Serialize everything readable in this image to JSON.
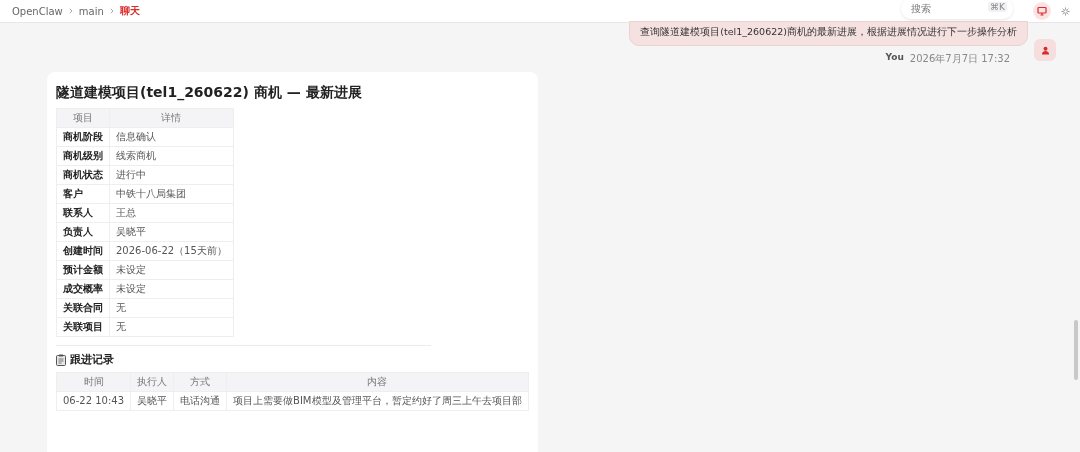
{
  "breadcrumb": [
    {
      "label": "OpenClaw",
      "selected": false
    },
    {
      "label": "main",
      "selected": false
    },
    {
      "label": "聊天",
      "selected": true
    }
  ],
  "search": {
    "placeholder": "搜索",
    "shortcut": "⌘K"
  },
  "message": {
    "text": "查询隧道建模项目(tel1_260622)商机的最新进展，根据进展情况进行下一步操作分析",
    "author": "You",
    "time": "2026年7月7日 17:32"
  },
  "reply": {
    "title": "隧道建模项目(tel1_260622) 商机 — 最新进展",
    "detail_table": {
      "columns": [
        "项目",
        "详情"
      ],
      "rows": [
        [
          "商机阶段",
          "信息确认"
        ],
        [
          "商机级别",
          "线索商机"
        ],
        [
          "商机状态",
          "进行中"
        ],
        [
          "客户",
          "中铁十八局集团"
        ],
        [
          "联系人",
          "王总"
        ],
        [
          "负责人",
          "吴晓平"
        ],
        [
          "创建时间",
          "2026-06-22（15天前）"
        ],
        [
          "预计金额",
          "未设定"
        ],
        [
          "成交概率",
          "未设定"
        ],
        [
          "关联合同",
          "无"
        ],
        [
          "关联项目",
          "无"
        ]
      ]
    },
    "section_title": "跟进记录",
    "records_table": {
      "columns": [
        "时间",
        "执行人",
        "方式",
        "内容"
      ],
      "rows": [
        [
          "06-22 10:43",
          "吴晓平",
          "电话沟通",
          "项目上需要做BIM模型及管理平台，暂定约好了周三上午去项目部"
        ]
      ]
    }
  }
}
